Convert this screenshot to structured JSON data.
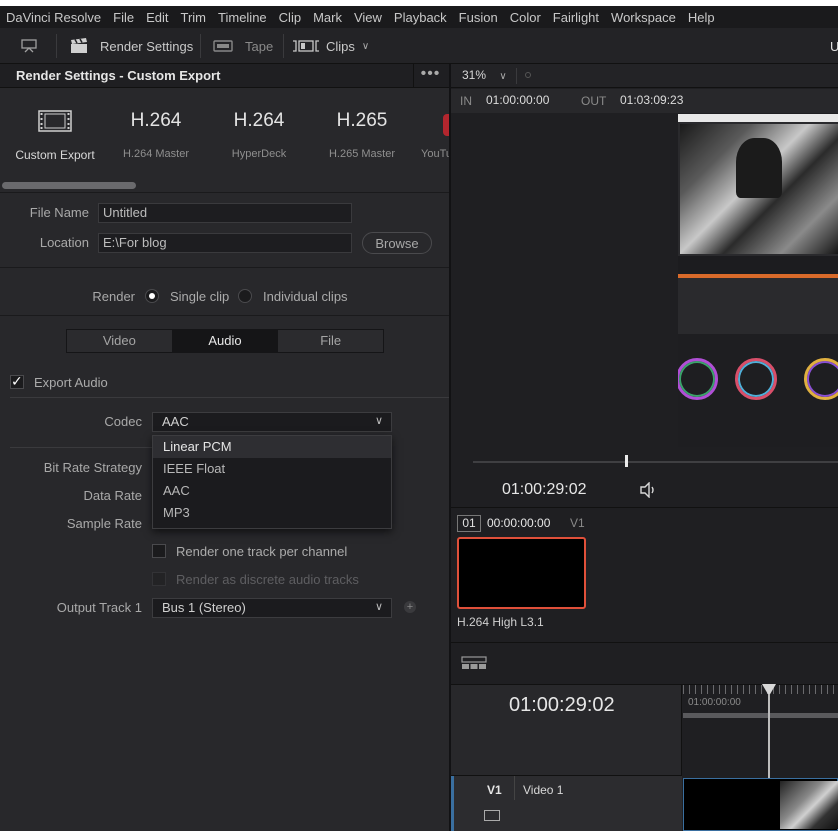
{
  "menubar": [
    "DaVinci Resolve",
    "File",
    "Edit",
    "Trim",
    "Timeline",
    "Clip",
    "Mark",
    "View",
    "Playback",
    "Fusion",
    "Color",
    "Fairlight",
    "Workspace",
    "Help"
  ],
  "toolbar": {
    "render_settings": "Render Settings",
    "tape": "Tape",
    "clips": "Clips",
    "right_cut": "U"
  },
  "panel": {
    "title": "Render Settings - Custom Export",
    "presets": [
      {
        "big": "",
        "label": "Custom Export"
      },
      {
        "big": "H.264",
        "label": "H.264 Master"
      },
      {
        "big": "H.264",
        "label": "HyperDeck"
      },
      {
        "big": "H.265",
        "label": "H.265 Master"
      },
      {
        "big": "",
        "label": "YouTu"
      }
    ],
    "file_name_label": "File Name",
    "file_name_value": "Untitled",
    "location_label": "Location",
    "location_value": "E:\\For blog",
    "browse": "Browse",
    "render_label": "Render",
    "single_clip": "Single clip",
    "individual_clips": "Individual clips",
    "tabs": [
      "Video",
      "Audio",
      "File"
    ],
    "export_audio": "Export Audio",
    "codec_label": "Codec",
    "codec_value": "AAC",
    "codec_options": [
      "Linear PCM",
      "IEEE Float",
      "AAC",
      "MP3"
    ],
    "bit_rate_strategy": "Bit Rate Strategy",
    "data_rate": "Data Rate",
    "sample_rate": "Sample Rate",
    "render_one_track": "Render one track per channel",
    "render_discrete": "Render as discrete audio tracks",
    "output_track_label": "Output Track 1",
    "output_track_value": "Bus 1 (Stereo)"
  },
  "viewer": {
    "zoom": "31%",
    "in_label": "IN",
    "in_tc": "01:00:00:00",
    "out_label": "OUT",
    "out_tc": "01:03:09:23",
    "current_tc": "01:00:29:02",
    "clip_index": "01",
    "clip_tc": "00:00:00:00",
    "clip_track": "V1",
    "clip_name": "H.264 High L3.1",
    "timeline_tc": "01:00:29:02",
    "ruler_tc": "01:00:00:00",
    "track_label": "V1",
    "track_name": "Video 1"
  },
  "colors": {
    "bg": "#28282b",
    "accent_red": "#e0503a",
    "text": "#bdbdbd"
  }
}
